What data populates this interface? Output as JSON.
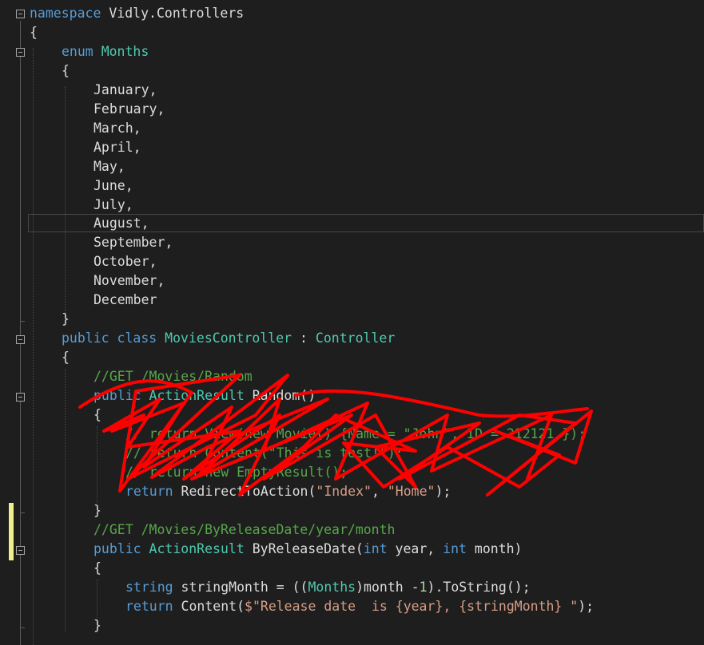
{
  "editor": {
    "lines": {
      "l0": {
        "namespace_kw": "namespace",
        "name": "Vidly.Controllers"
      },
      "l1": {
        "text": "{"
      },
      "l2": {
        "kw": "enum",
        "name": "Months"
      },
      "l3": {
        "text": "{"
      },
      "l4": {
        "text": "January,"
      },
      "l5": {
        "text": "February,"
      },
      "l6": {
        "text": "March,"
      },
      "l7": {
        "text": "April,"
      },
      "l8": {
        "text": "May,"
      },
      "l9": {
        "text": "June,"
      },
      "l10": {
        "text": "July,"
      },
      "l11": {
        "text": "August,"
      },
      "l12": {
        "text": "September,"
      },
      "l13": {
        "text": "October,"
      },
      "l14": {
        "text": "November,"
      },
      "l15": {
        "text": "December"
      },
      "l16": {
        "text": "}"
      },
      "l17": {
        "kw1": "public",
        "kw2": "class",
        "name": "MoviesController",
        "colon": " : ",
        "base": "Controller"
      },
      "l18": {
        "text": "{"
      },
      "l19": {
        "comment": "//GET /Movies/Random"
      },
      "l20": {
        "kw": "public",
        "type": "ActionResult",
        "rest": " Random()"
      },
      "l21": {
        "text": "{"
      },
      "l22": {
        "comment": "// return View(new Movie() {Name = \"John\", ID = 212121 });"
      },
      "l23": {
        "comment": "// return Content(\"This is test!\");"
      },
      "l24": {
        "comment": "// return new EmptyResult();"
      },
      "l25": {
        "kw": "return",
        "call": " RedirectToAction(",
        "s1": "\"Index\"",
        "sep": ", ",
        "s2": "\"Home\"",
        "end": ");"
      },
      "l26": {
        "text": "}"
      },
      "l27": {
        "comment": "//GET /Movies/ByReleaseDate/year/month"
      },
      "l28": {
        "kw": "public",
        "type": "ActionResult",
        "name": " ByReleaseDate(",
        "t1": "int",
        "p1": " year, ",
        "t2": "int",
        "p2": " month)"
      },
      "l29": {
        "text": "{"
      },
      "l30": {
        "kw": "string",
        "a": " stringMonth = ((",
        "type": "Months",
        "b": ")month -",
        "num": "1",
        "c": ").ToString();"
      },
      "l31": {
        "kw": "return",
        "a": " Content(",
        "str": "$\"Release date  is {year}, {stringMonth} \"",
        "c": ");"
      },
      "l32": {
        "text": "}"
      }
    }
  },
  "colors": {
    "background": "#1e1e1e",
    "keyword": "#569cd6",
    "type": "#4ec9b0",
    "comment": "#57a64a",
    "string": "#d69d85",
    "number": "#b5cea8",
    "text": "#dcdcdc",
    "scribble": "#ff0000",
    "change_marker": "#efef8b"
  },
  "icons": [
    "collapse-icon"
  ]
}
